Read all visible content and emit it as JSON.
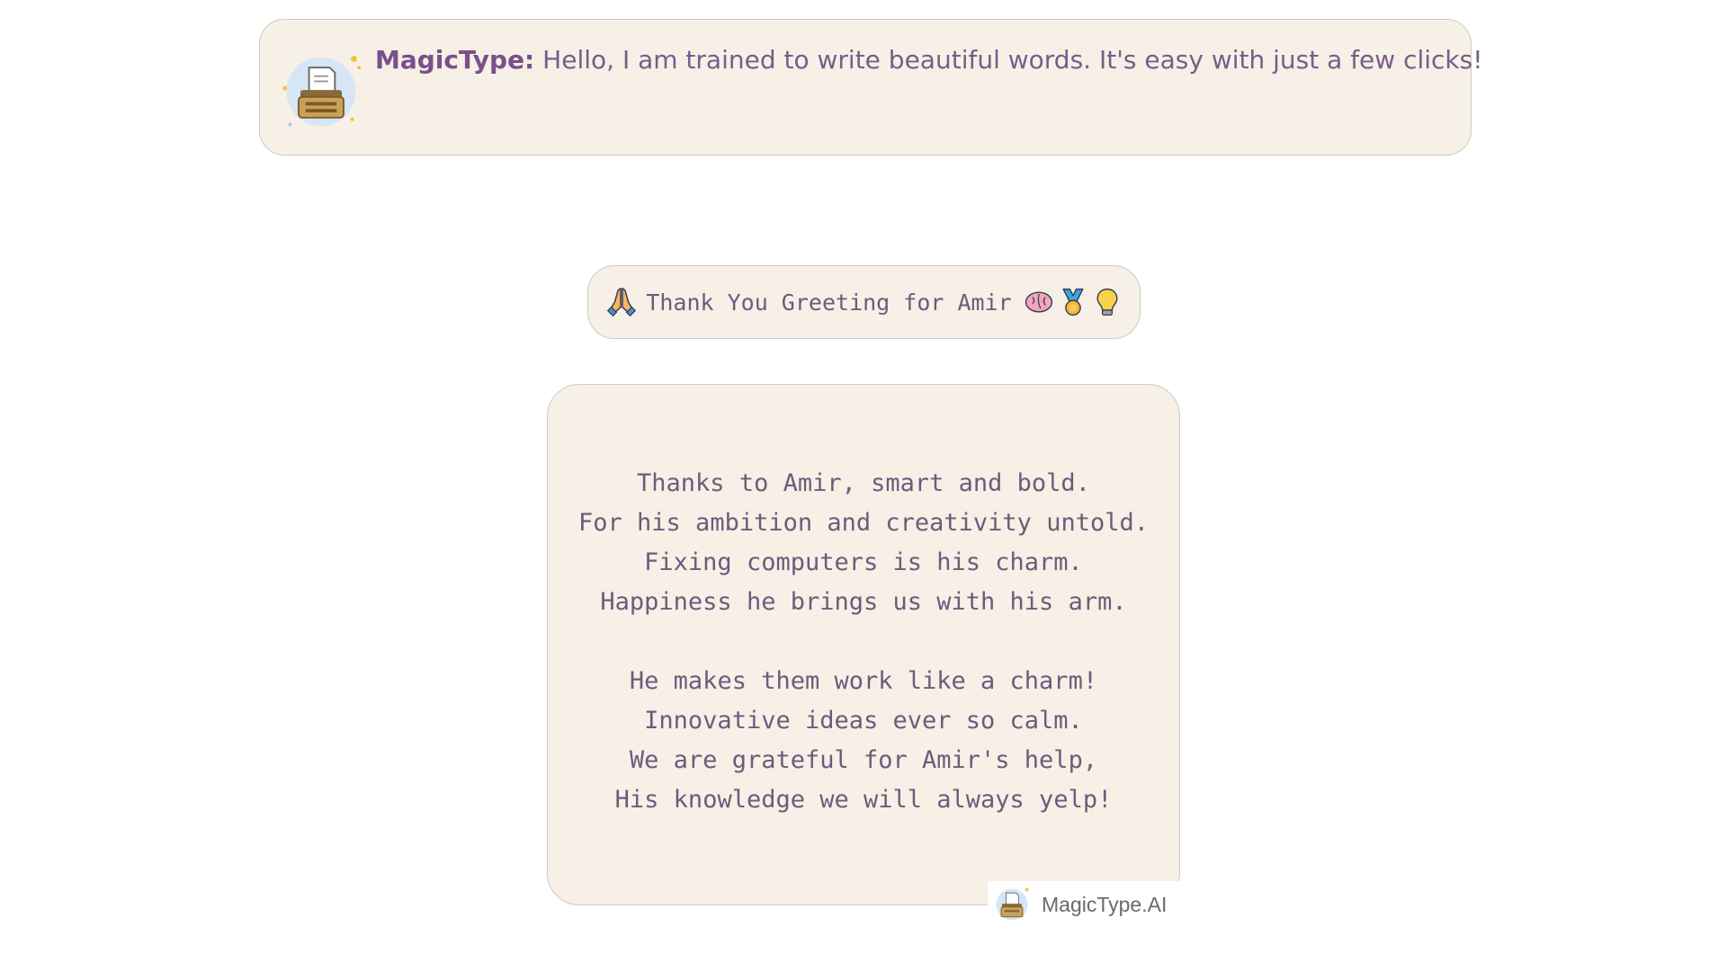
{
  "intro": {
    "name": "MagicType:",
    "message": " Hello, I am trained to write beautiful words. It's easy with just a few clicks!",
    "avatar_icon": "typewriter-icon"
  },
  "title": {
    "text": "Thank You Greeting for Amir",
    "leading_icon": "folded-hands-icon",
    "trailing_icons": [
      "brain-icon",
      "medal-icon",
      "lightbulb-icon"
    ]
  },
  "poem": {
    "stanza1": [
      "Thanks to Amir, smart and bold.",
      "For his ambition and creativity untold.",
      "Fixing computers is his charm.",
      "Happiness he brings us with his arm."
    ],
    "stanza2": [
      "He makes them work like a charm!",
      "Innovative ideas ever so calm.",
      "We are grateful for Amir's help,",
      "His knowledge we will always yelp!"
    ]
  },
  "watermark": {
    "text": "MagicType.AI",
    "icon": "typewriter-icon"
  },
  "colors": {
    "card_background": "#f6f0e6",
    "card_border": "#cfcac2",
    "text_purple": "#7a5c8a",
    "name_purple": "#7b4f8c"
  }
}
